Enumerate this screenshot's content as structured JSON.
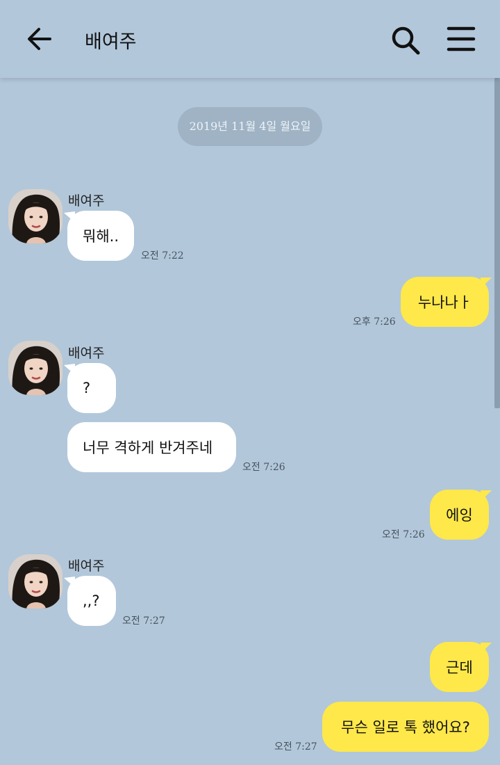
{
  "header": {
    "title": "배여주",
    "back_icon": "arrow-left-icon",
    "search_icon": "search-icon",
    "menu_icon": "hamburger-menu-icon"
  },
  "colors": {
    "background": "#b2c7da",
    "incoming_bubble": "#ffffff",
    "outgoing_bubble": "#fee84a",
    "date_pill": "#9fb3c5"
  },
  "date_divider": "2019년 11월 4일 월요일",
  "messages": [
    {
      "sender": "배여주",
      "text": "뭐해..",
      "time": "오전 7:22"
    },
    {
      "sender": "me",
      "text": "누나나ㅏ",
      "time": "오후 7:26"
    },
    {
      "sender": "배여주",
      "text": "?",
      "time": ""
    },
    {
      "sender": "배여주",
      "text": "너무 격하게 반겨주네",
      "time": "오전 7:26"
    },
    {
      "sender": "me",
      "text": "에잉",
      "time": "오전 7:26"
    },
    {
      "sender": "배여주",
      "text": ",,?",
      "time": "오전 7:27"
    },
    {
      "sender": "me",
      "text": "근데",
      "time": ""
    },
    {
      "sender": "me",
      "text": "무슨 일로 톡 했어요?",
      "time": "오전 7:27"
    }
  ]
}
